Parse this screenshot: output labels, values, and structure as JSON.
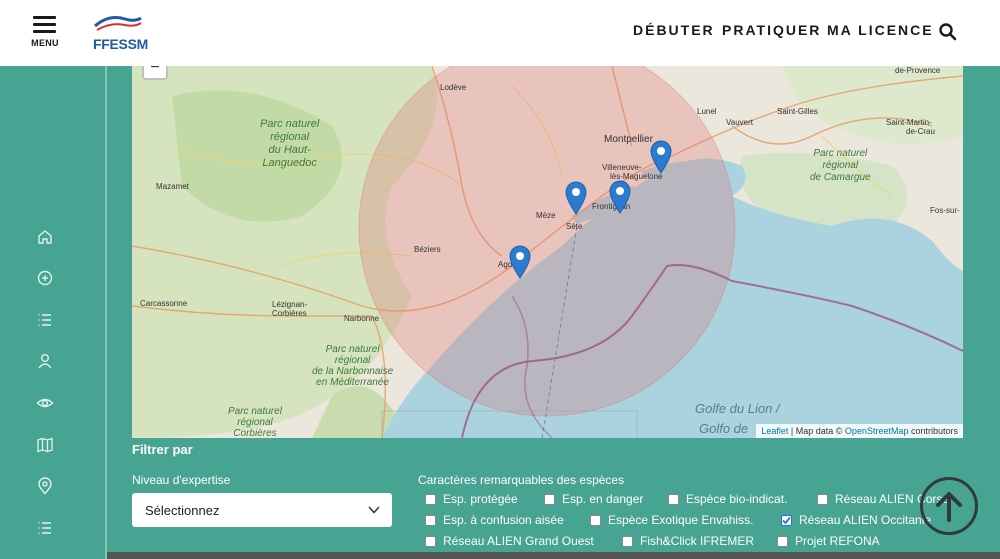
{
  "header": {
    "menu_label": "MENU",
    "logo_text": "FFESSM",
    "nav": [
      {
        "label": "DÉBUTER"
      },
      {
        "label": "PRATIQUER"
      },
      {
        "label": "MA LICENCE"
      }
    ]
  },
  "rail_icons": [
    "home-icon",
    "add-circle-icon",
    "list-icon",
    "user-icon",
    "eye-icon",
    "map-icon",
    "location-pin-icon",
    "list-icon"
  ],
  "map": {
    "zoom_out": "−",
    "places": {
      "lodeve": "Lodève",
      "montpellier": "Montpellier",
      "villeneuve": "Villeneuve-",
      "maguelone": "lès-Maguelone",
      "frontignan": "Frontignan",
      "meze": "Mèze",
      "sete": "Sète",
      "beziers": "Béziers",
      "agde": "Agde",
      "mazamet": "Mazamet",
      "carcassonne": "Carcassonne",
      "lezignan": "Lézignan-",
      "corbieres": "Corbières",
      "narbonne": "Narbonne",
      "lunel": "Lunel",
      "vauvert": "Vauvert",
      "saint_gilles": "Saint-Gilles",
      "provence": "de-Provence",
      "saint_martin": "Saint-Martin-",
      "de_crau": "de-Crau",
      "fos": "Fos-sur-"
    },
    "parks": {
      "haut_languedoc": [
        "Parc naturel",
        "régional",
        "du Haut-",
        "Languedoc"
      ],
      "camargue": [
        "Parc naturel",
        "régional",
        "de Camargue"
      ],
      "narbonnaise": [
        "Parc naturel",
        "régional",
        "de la Narbonnaise",
        "en Méditerranée"
      ],
      "corbieres_park": [
        "Parc naturel",
        "régional",
        "Corbières"
      ]
    },
    "sea": {
      "line1": "Golfe du Lion /",
      "line2": "Golfo de"
    },
    "attribution": {
      "leaflet": "Leaflet",
      "sep": " | Map data © ",
      "osm": "OpenStreetMap",
      "contrib": " contributors"
    },
    "markers": 4
  },
  "filters": {
    "title": "Filtrer par",
    "expertise_label": "Niveau d'expertise",
    "expertise_value": "Sélectionnez",
    "traits_label": "Caractères remarquables des espèces",
    "checkboxes": [
      {
        "label": "Esp. protégée",
        "checked": false
      },
      {
        "label": "Esp. en danger",
        "checked": false
      },
      {
        "label": "Espèce bio-indicat.",
        "checked": false
      },
      {
        "label": "Réseau ALIEN Corse",
        "checked": false
      },
      {
        "label": "Esp. à confusion aisée",
        "checked": false
      },
      {
        "label": "Espèce Exotique Envahiss.",
        "checked": false
      },
      {
        "label": "Réseau ALIEN Occitanie",
        "checked": true
      },
      {
        "label": "Réseau ALIEN Grand Ouest",
        "checked": false
      },
      {
        "label": "Fish&Click IFREMER",
        "checked": false
      },
      {
        "label": "Projet REFONA",
        "checked": false
      }
    ]
  },
  "colors": {
    "teal": "#47a392",
    "marker": "#2b7bd1",
    "radius_fill": "#e36b6b",
    "sea": "#aad3df"
  }
}
